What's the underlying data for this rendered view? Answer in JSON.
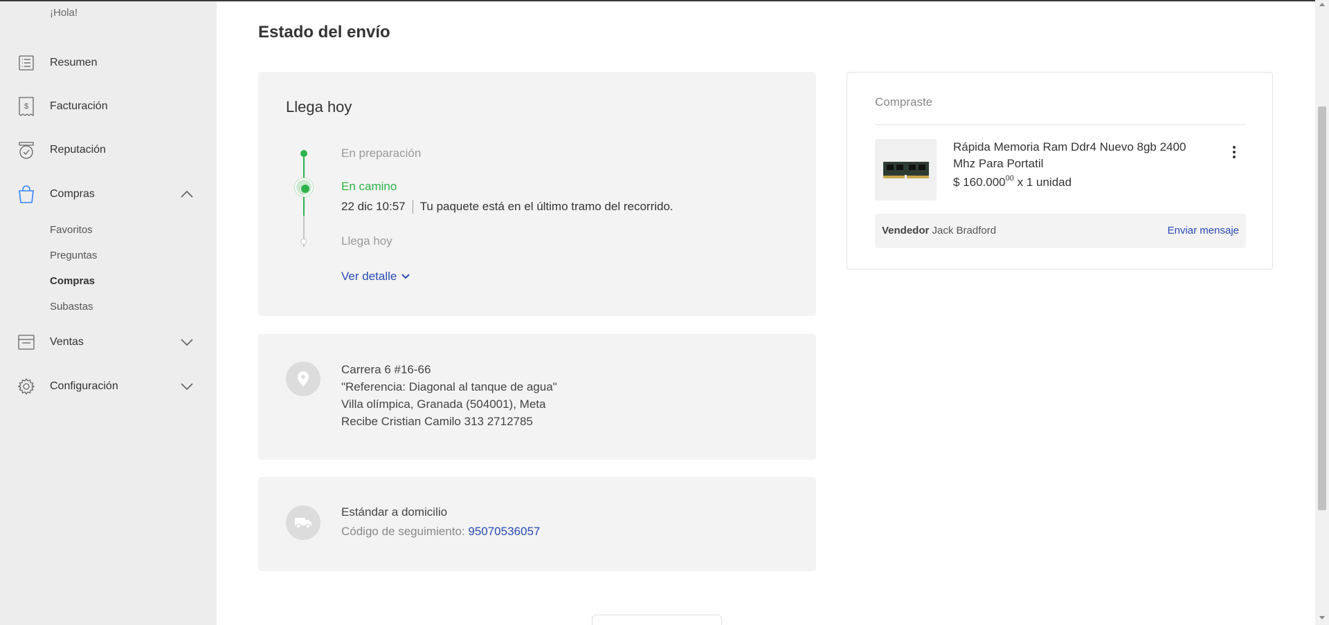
{
  "sidebar": {
    "greeting": "¡Hola!",
    "items": [
      {
        "label": "Resumen",
        "icon": "summary-icon"
      },
      {
        "label": "Facturación",
        "icon": "billing-icon"
      },
      {
        "label": "Reputación",
        "icon": "reputation-icon"
      },
      {
        "label": "Compras",
        "icon": "shopping-bag-icon"
      },
      {
        "label": "Ventas",
        "icon": "store-icon"
      },
      {
        "label": "Configuración",
        "icon": "gear-icon"
      }
    ],
    "subitems": [
      {
        "label": "Favoritos"
      },
      {
        "label": "Preguntas"
      },
      {
        "label": "Compras"
      },
      {
        "label": "Subastas"
      }
    ]
  },
  "main": {
    "title": "Estado del envío",
    "status": {
      "title": "Llega hoy",
      "steps": [
        {
          "label": "En preparación"
        },
        {
          "label": "En camino"
        },
        {
          "label": "Llega hoy"
        }
      ],
      "detail_time": "22 dic 10:57",
      "detail_text": "Tu paquete está en el último tramo del recorrido.",
      "more_link": "Ver detalle"
    },
    "address": {
      "lines": [
        "Carrera 6 #16-66",
        "\"Referencia: Diagonal al tanque de agua\"",
        "Villa olímpica, Granada (504001), Meta",
        "Recibe Cristian Camilo 313 2712785"
      ]
    },
    "shipping": {
      "method": "Estándar a domicilio",
      "tracking_label": "Código de seguimiento:",
      "tracking_code": "95070536057"
    }
  },
  "purchase": {
    "heading": "Compraste",
    "product_title": "Rápida Memoria Ram Ddr4 Nuevo 8gb 2400 Mhz Para Portatil",
    "price_main": "$ 160.000",
    "price_cents": "00",
    "quantity": "x 1 unidad",
    "seller_label": "Vendedor",
    "seller_name": "Jack Bradford",
    "message_link": "Enviar mensaje"
  },
  "colors": {
    "accent_green": "#2db34a",
    "link_blue": "#2a4ab4",
    "sidebar_bg": "#ededed",
    "card_bg": "#f3f3f3"
  }
}
